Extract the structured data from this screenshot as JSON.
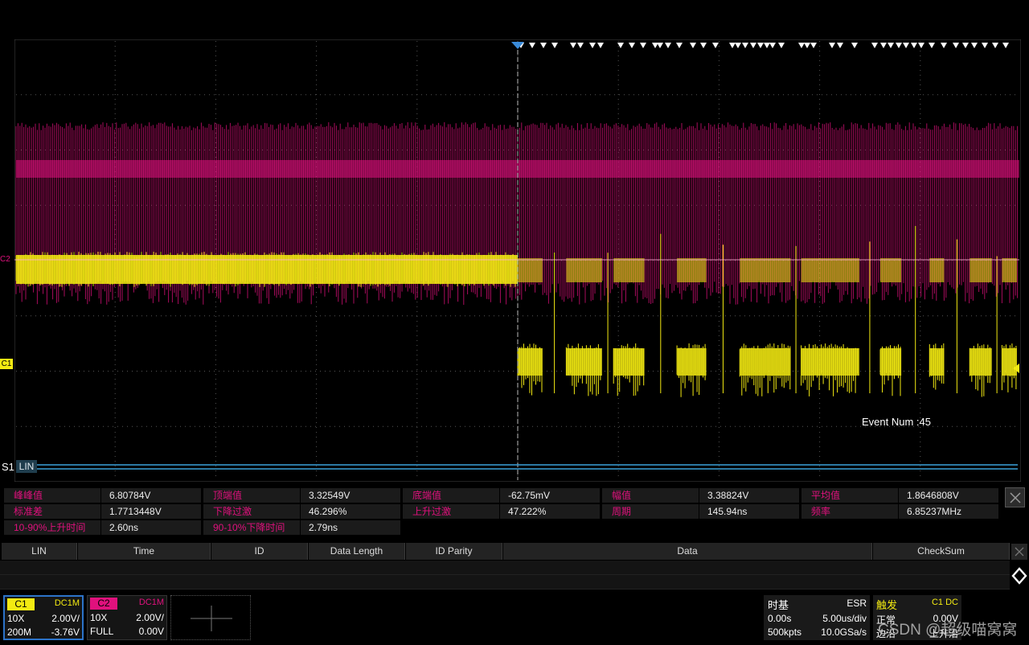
{
  "display": {
    "ch2_marker": "C2",
    "ch1_marker": "C1",
    "event_num": "Event Num :45",
    "serial_label": "S1",
    "serial_protocol": "LIN"
  },
  "measurements": [
    {
      "name": "峰峰值",
      "value": "6.80784V"
    },
    {
      "name": "顶端值",
      "value": "3.32549V"
    },
    {
      "name": "底端值",
      "value": "-62.75mV"
    },
    {
      "name": "幅值",
      "value": "3.38824V"
    },
    {
      "name": "平均值",
      "value": "1.8646808V"
    },
    {
      "name": "标准差",
      "value": "1.7713448V"
    },
    {
      "name": "下降过激",
      "value": "46.296%"
    },
    {
      "name": "上升过激",
      "value": "47.222%"
    },
    {
      "name": "周期",
      "value": "145.94ns"
    },
    {
      "name": "频率",
      "value": "6.85237MHz"
    },
    {
      "name": "10-90%上升时间",
      "value": "2.60ns"
    },
    {
      "name": "90-10%下降时间",
      "value": "2.79ns"
    }
  ],
  "decode_table": {
    "headers": [
      "LIN",
      "Time",
      "ID",
      "Data Length",
      "ID Parity",
      "Data",
      "CheckSum"
    ]
  },
  "channels": {
    "c1": {
      "label": "C1",
      "coupling": "DC1M",
      "probe": "10X",
      "scale": "2.00V/",
      "bandwidth": "200M",
      "offset": "-3.76V"
    },
    "c2": {
      "label": "C2",
      "coupling": "DC1M",
      "probe": "10X",
      "scale": "2.00V/",
      "bandwidth": "FULL",
      "offset": "0.00V"
    }
  },
  "timebase": {
    "title": "时基",
    "mode": "ESR",
    "delay": "0.00s",
    "scale": "5.00us/div",
    "memory": "500kpts",
    "sample_rate": "10.0GSa/s"
  },
  "trigger": {
    "title": "触发",
    "source": "C1 DC",
    "mode": "正常",
    "level": "0.00V",
    "type": "边沿",
    "slope": "上升沿"
  },
  "watermark": "CSDN @超级喵窝窝",
  "colors": {
    "ch1": "#f3ea12",
    "ch2": "#e0117d",
    "serial": "#3aa0d8",
    "accent": "#2c73c9"
  }
}
